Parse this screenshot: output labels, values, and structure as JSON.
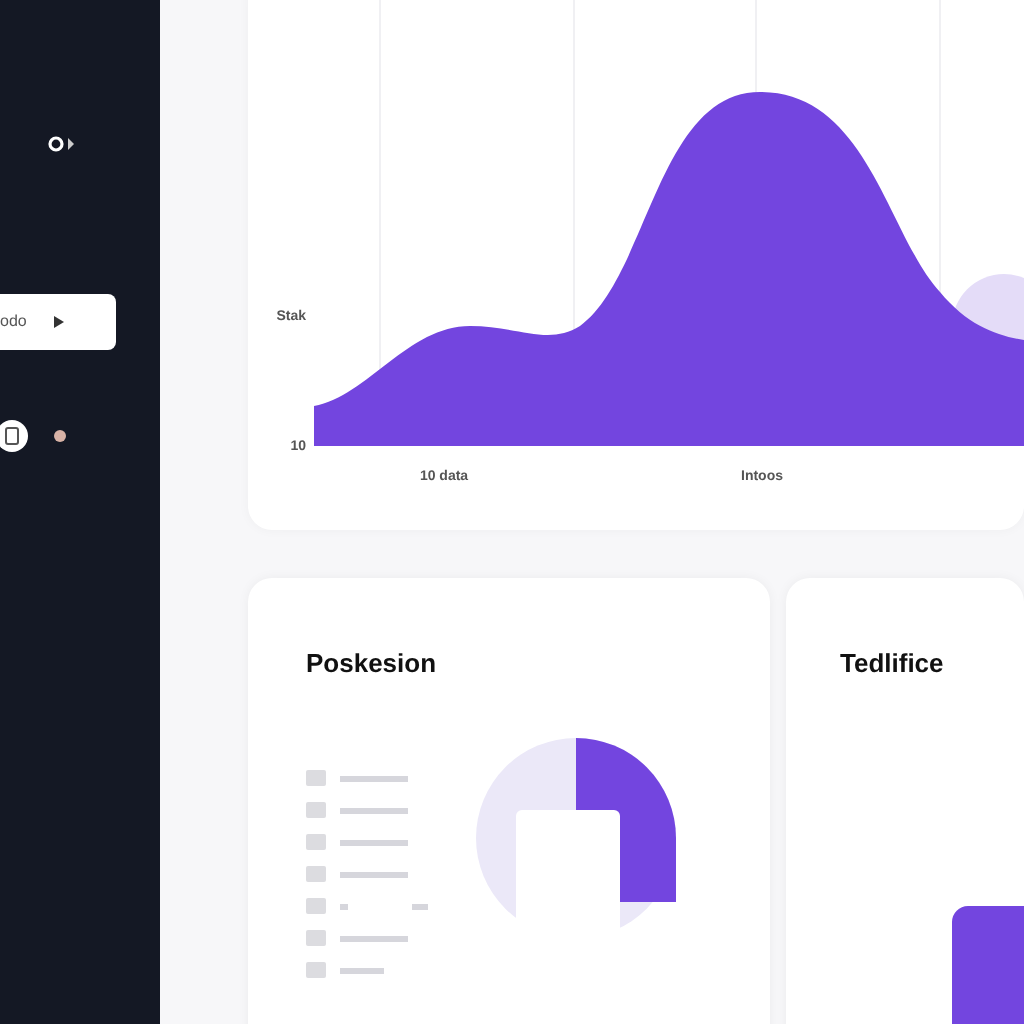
{
  "sidebar": {
    "nav_button": {
      "label": "odo"
    }
  },
  "trend_card": {
    "y_labels": [
      "Stak",
      "10"
    ],
    "x_labels": [
      "10 data",
      "Intoos"
    ]
  },
  "position_card": {
    "title": "Poskesion",
    "legend": [
      {
        "kind": "long"
      },
      {
        "kind": "long"
      },
      {
        "kind": "long"
      },
      {
        "kind": "long"
      },
      {
        "kind": "split"
      },
      {
        "kind": "long"
      },
      {
        "kind": "short"
      }
    ]
  },
  "second_card": {
    "title": "Tedlifice"
  }
}
